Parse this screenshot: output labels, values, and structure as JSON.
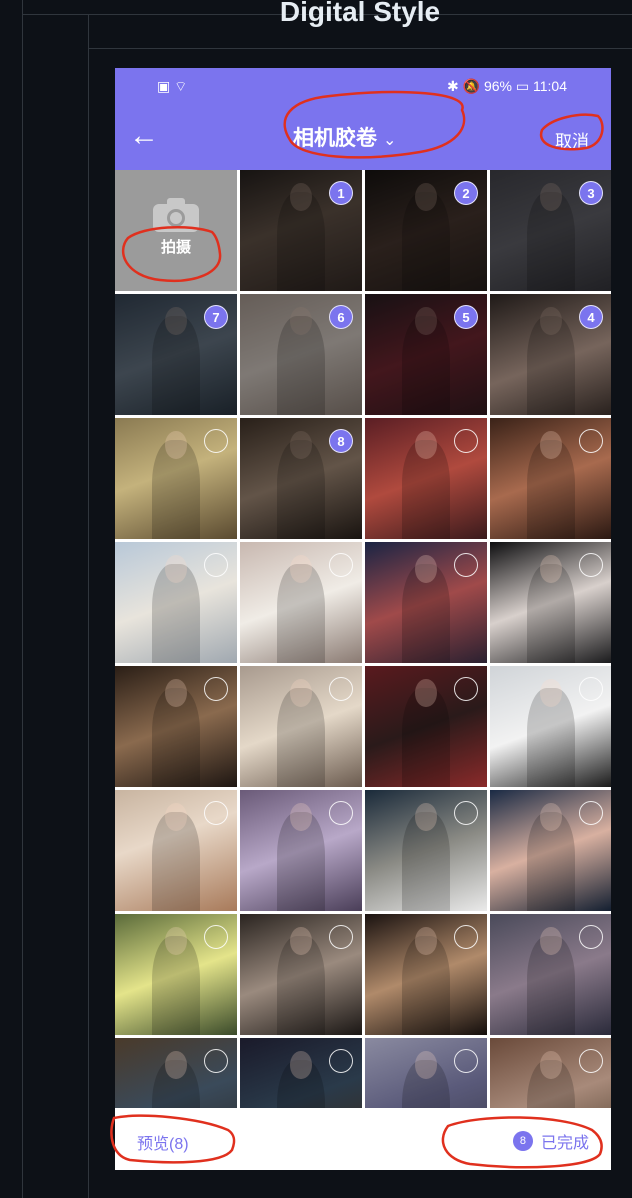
{
  "doc": {
    "heading": "Digital Style"
  },
  "status_bar": {
    "left_icons": "▣ ⌔",
    "right": "✱ 🔕 96% ▭ 11:04"
  },
  "header": {
    "back_icon": "arrow-left-icon",
    "title": "相机胶卷",
    "title_chevron": "⌄",
    "cancel_label": "取消",
    "color": "#7b74ee"
  },
  "camera_tile": {
    "label": "拍摄",
    "icon": "camera-icon"
  },
  "photos": [
    {
      "badge": "1",
      "bg": "linear-gradient(160deg,#2a2421 0%,#6b5a4e 45%,#3a2f2a 100%)"
    },
    {
      "badge": "2",
      "bg": "linear-gradient(160deg,#1a1614 0%,#4d3b33 50%,#2b221e 100%)"
    },
    {
      "badge": "3",
      "bg": "linear-gradient(160deg,#4a4a52 0%,#6a6a72 50%,#3b3b42 100%)"
    },
    {
      "badge": "7",
      "bg": "linear-gradient(160deg,#3b4a5c 0%,#6f7f8f 50%,#2e3b48 100%)"
    },
    {
      "badge": "6",
      "bg": "linear-gradient(160deg,#b9aaa0 0%,#e6dcd4 50%,#9d8e84 100%)"
    },
    {
      "badge": "5",
      "bg": "linear-gradient(160deg,#2c1f24 0%,#7a2a35 50%,#3a1e24 100%)"
    },
    {
      "badge": "4",
      "bg": "linear-gradient(160deg,#3a302c 0%,#d8b8a8 55%,#4a3c36 100%)"
    },
    {
      "badge": "",
      "bg": "linear-gradient(160deg,#8a7a52 0%,#c4b27c 45%,#5a4a30 100%)"
    },
    {
      "badge": "8",
      "bg": "linear-gradient(160deg,#4a3a2e 0%,#b49a84 50%,#2e241e 100%)"
    },
    {
      "badge": "",
      "bg": "linear-gradient(160deg,#5a1e24 0%,#b04a3e 50%,#3a1a1c 100%)"
    },
    {
      "badge": "",
      "bg": "linear-gradient(160deg,#3a2218 0%,#a86a4e 50%,#2a1812 100%)"
    },
    {
      "badge": "",
      "bg": "linear-gradient(160deg,#b8c8d8 0%,#e8e4dc 50%,#a0a8b0 100%)"
    },
    {
      "badge": "",
      "bg": "linear-gradient(160deg,#c8b8b0 0%,#f0ece6 50%,#8a7a72 100%)"
    },
    {
      "badge": "",
      "bg": "linear-gradient(160deg,#1a2444 0%,#a04a4a 50%,#2a2030 100%)"
    },
    {
      "badge": "",
      "bg": "linear-gradient(160deg,#0e0e10 0%,#d8d0cc 50%,#1a1a1c 100%)"
    },
    {
      "badge": "",
      "bg": "linear-gradient(160deg,#2a1e16 0%,#8a6a4e 50%,#1e1612 100%)"
    },
    {
      "badge": "",
      "bg": "linear-gradient(160deg,#a89a8e 0%,#e4d8c8 50%,#6a5a4e 100%)"
    },
    {
      "badge": "",
      "bg": "linear-gradient(160deg,#5a1a1e 0%,#2a1a1a 50%,#8a2a2a 100%)"
    },
    {
      "badge": "",
      "bg": "linear-gradient(160deg,#d0d4d8 0%,#f2f2f2 50%,#1a1a1a 100%)"
    },
    {
      "badge": "",
      "bg": "linear-gradient(160deg,#c8b4a0 0%,#e8d8c8 40%,#a87a5a 100%)"
    },
    {
      "badge": "",
      "bg": "linear-gradient(160deg,#6a5a78 0%,#b8a8c8 50%,#4a3e58 100%)"
    },
    {
      "badge": "",
      "bg": "linear-gradient(160deg,#1a2a3a 0%,#8a8a84 50%,#eaeaea 100%)"
    },
    {
      "badge": "",
      "bg": "linear-gradient(160deg,#1a2a44 0%,#d8b0a0 50%,#121e30 100%)"
    },
    {
      "badge": "",
      "bg": "linear-gradient(160deg,#5a6a3a 0%,#e4e48a 50%,#3a4a2a 100%)"
    },
    {
      "badge": "",
      "bg": "linear-gradient(160deg,#2a2420 0%,#9a8a7e 50%,#1a1614 100%)"
    },
    {
      "badge": "",
      "bg": "linear-gradient(160deg,#1a1210 0%,#b08a6a 50%,#140e0c 100%)"
    },
    {
      "badge": "",
      "bg": "linear-gradient(160deg,#4a4a5a 0%,#8a7a8a 50%,#2a2a3a 100%)"
    },
    {
      "badge": "",
      "bg": "linear-gradient(160deg,#4a3a2a 0%,#3a4a5a 50%,#2a2a2a 100%)"
    },
    {
      "badge": "",
      "bg": "linear-gradient(160deg,#1a1a2a 0%,#2a3a4a 50%,#3a2a1a 100%)"
    },
    {
      "badge": "",
      "bg": "linear-gradient(160deg,#8a8aa0 0%,#5a5a7a 50%,#3a3a4a 100%)"
    },
    {
      "badge": "",
      "bg": "linear-gradient(160deg,#6a4a3a 0%,#a88a7a 50%,#4a3a2a 100%)"
    }
  ],
  "bottom_bar": {
    "preview_label": "预览(8)",
    "done_count": "8",
    "done_label": "已完成"
  }
}
